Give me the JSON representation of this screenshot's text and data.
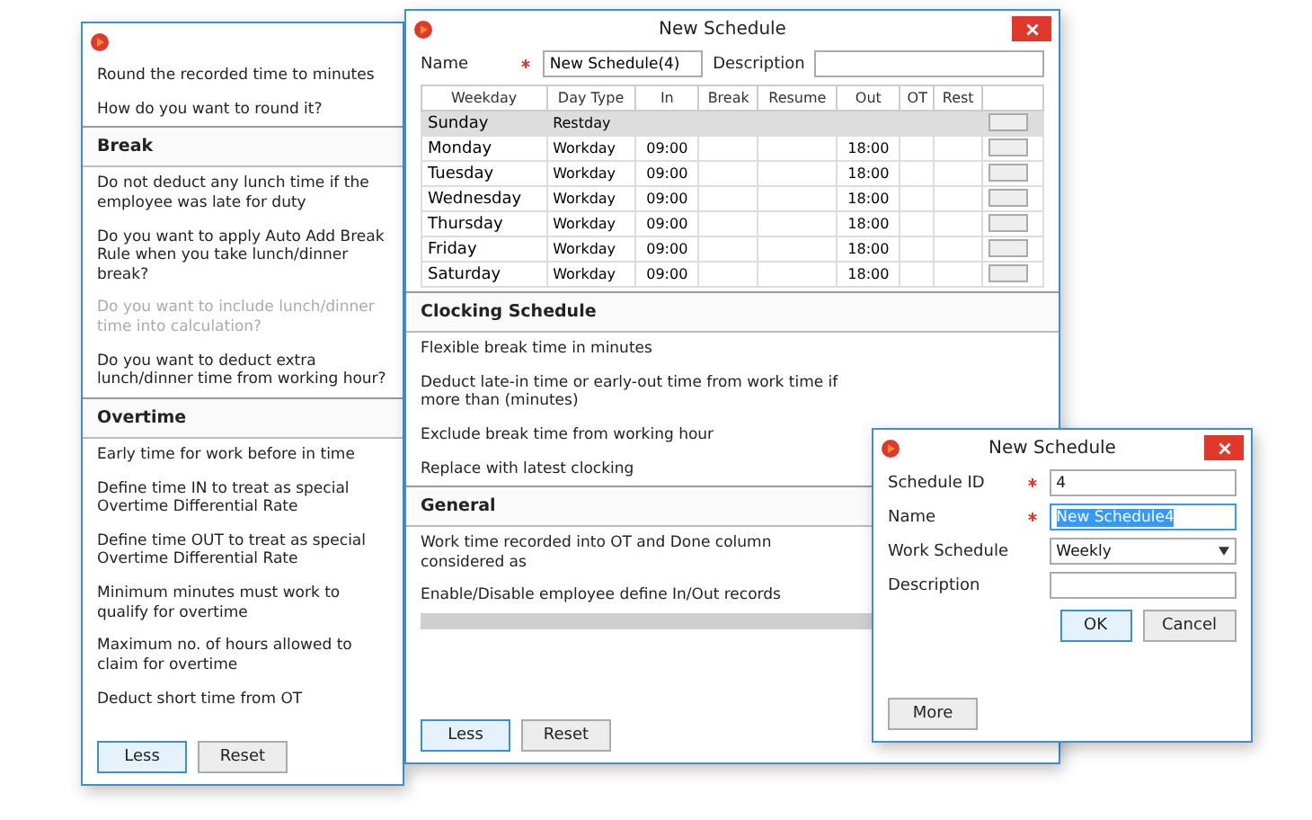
{
  "rules_window": {
    "rounding": [
      "Round the recorded time to minutes",
      "How do you want to round it?"
    ],
    "sections": [
      {
        "title": "Break",
        "items": [
          {
            "label": "Do not deduct any lunch time if the employee was late for duty",
            "disabled": false
          },
          {
            "label": "Do you want to apply Auto Add Break Rule when you take lunch/dinner break?",
            "disabled": false
          },
          {
            "label": "Do you want to include lunch/dinner time into calculation?",
            "disabled": true
          },
          {
            "label": "Do you want to deduct extra lunch/dinner time from working hour?",
            "disabled": false
          }
        ]
      },
      {
        "title": "Overtime",
        "items": [
          {
            "label": "Early time for work before in time",
            "disabled": false
          },
          {
            "label": "Define time IN to treat as special Overtime Differential Rate",
            "disabled": false
          },
          {
            "label": "Define time OUT to treat as special Overtime Differential Rate",
            "disabled": false
          },
          {
            "label": "Minimum minutes must work to qualify for overtime",
            "disabled": false
          },
          {
            "label": "Maximum no. of hours allowed to claim for overtime",
            "disabled": false
          },
          {
            "label": "Deduct short time from OT",
            "disabled": false
          }
        ]
      }
    ],
    "buttons": [
      {
        "label": "Less",
        "focused": true
      },
      {
        "label": "Reset",
        "focused": false
      }
    ]
  },
  "schedule_window": {
    "title": "New Schedule",
    "name_label": "Name",
    "name_value": "New Schedule(4)",
    "description_label": "Description",
    "table": {
      "columns": [
        "Weekday",
        "Day Type",
        "In",
        "Break",
        "Resume",
        "Out",
        "OT",
        "Rest"
      ],
      "rows": [
        {
          "weekday": "Sunday",
          "day_type": "Restday",
          "selected": true
        },
        {
          "weekday": "Monday",
          "day_type": "Workday",
          "in": "09:00",
          "out": "18:00",
          "selected": false
        },
        {
          "weekday": "Tuesday",
          "day_type": "Workday",
          "in": "09:00",
          "out": "18:00",
          "selected": false
        },
        {
          "weekday": "Wednesday",
          "day_type": "Workday",
          "in": "09:00",
          "out": "18:00",
          "selected": false
        },
        {
          "weekday": "Thursday",
          "day_type": "Workday",
          "in": "09:00",
          "out": "18:00",
          "selected": false
        },
        {
          "weekday": "Friday",
          "day_type": "Workday",
          "in": "09:00",
          "out": "18:00",
          "selected": false
        },
        {
          "weekday": "Saturday",
          "day_type": "Workday",
          "in": "09:00",
          "out": "18:00",
          "selected": false
        }
      ]
    },
    "sections": [
      {
        "title": "Clocking Schedule",
        "items": [
          "Flexible break time in minutes",
          "Deduct late-in time or early-out time from work time if more than (minutes)",
          "Exclude break time from working hour",
          "Replace with latest clocking"
        ]
      },
      {
        "title": "General",
        "items": [
          "Work time recorded into OT and Done column considered as",
          "Enable/Disable employee define In/Out records"
        ]
      }
    ],
    "buttons": [
      {
        "label": "Less",
        "focused": true
      },
      {
        "label": "Reset",
        "focused": false
      }
    ]
  },
  "new_schedule_dialog": {
    "title": "New Schedule",
    "fields": [
      {
        "label": "Schedule ID",
        "required": true,
        "value": "4",
        "kind": "text",
        "highlighted": false
      },
      {
        "label": "Name",
        "required": true,
        "value": "New Schedule4",
        "kind": "text",
        "highlighted": true
      },
      {
        "label": "Work Schedule",
        "required": false,
        "value": "Weekly",
        "kind": "dropdown",
        "highlighted": false
      },
      {
        "label": "Description",
        "required": false,
        "kind": "text",
        "highlighted": false
      }
    ],
    "buttons": [
      {
        "label": "OK",
        "focused": true
      },
      {
        "label": "Cancel",
        "focused": false
      }
    ],
    "more_button": "More"
  }
}
